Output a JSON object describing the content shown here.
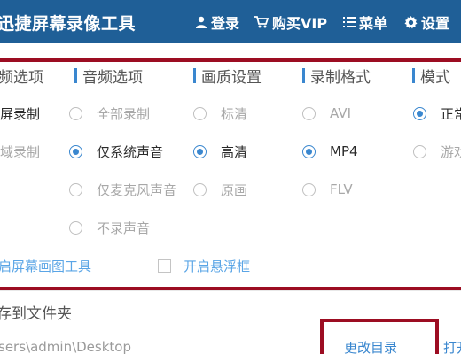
{
  "window": {
    "title": "迅捷屏幕录像工具",
    "title_color": "#1f5f97"
  },
  "titlebar": {
    "login_label": "登录",
    "buy_label": "购买VIP",
    "menu_label": "菜单",
    "settings_label": "设置"
  },
  "options": {
    "accent_color": "#3a87cf",
    "columns": [
      {
        "header": "频选项",
        "items": [
          {
            "label": "屏录制",
            "selected": true
          },
          {
            "label": "域录制",
            "selected": false
          }
        ]
      },
      {
        "header": "音频选项",
        "items": [
          {
            "label": "全部录制",
            "selected": false
          },
          {
            "label": "仅系统声音",
            "selected": true
          },
          {
            "label": "仅麦克风声音",
            "selected": false
          },
          {
            "label": "不录声音",
            "selected": false
          }
        ]
      },
      {
        "header": "画质设置",
        "items": [
          {
            "label": "标清",
            "selected": false
          },
          {
            "label": "高清",
            "selected": true
          },
          {
            "label": "原画",
            "selected": false
          }
        ]
      },
      {
        "header": "录制格式",
        "items": [
          {
            "label": "AVI",
            "selected": false
          },
          {
            "label": "MP4",
            "selected": true
          },
          {
            "label": "FLV",
            "selected": false
          }
        ]
      },
      {
        "header": "模式",
        "items": [
          {
            "label": "正常",
            "selected": true
          },
          {
            "label": "游戏",
            "selected": false
          }
        ]
      }
    ],
    "checkbox_brush": {
      "label": "启屏幕画图工具",
      "checked": false
    },
    "checkbox_float": {
      "label": "开启悬浮框",
      "checked": false
    }
  },
  "save": {
    "title": "存到文件夹",
    "path": "sers\\admin\\Desktop",
    "change_dir_label": "更改目录",
    "open_label": "打开"
  },
  "highlight_color": "#9c0d22",
  "icons": {
    "login": "user-icon",
    "buy": "cart-icon",
    "menu": "list-icon",
    "settings": "gear-icon"
  }
}
